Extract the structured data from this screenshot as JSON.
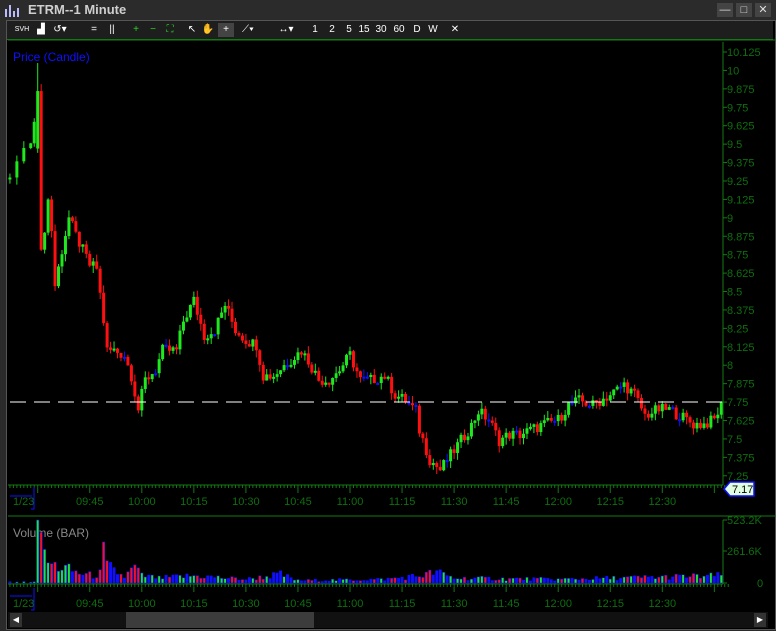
{
  "window": {
    "title": "ETRM--1 Minute",
    "minimize": "—",
    "restore": "□",
    "close": "✕"
  },
  "toolbar": {
    "items": [
      {
        "name": "svh-button",
        "label": "SVH"
      },
      {
        "name": "chart-type-button",
        "label": "▟"
      },
      {
        "name": "reset-button",
        "label": "↺▾"
      },
      {
        "name": "horizontal-line-button",
        "label": "="
      },
      {
        "name": "vertical-line-button",
        "label": "||"
      },
      {
        "name": "zoom-in-button",
        "label": "+"
      },
      {
        "name": "zoom-out-button",
        "label": "−"
      },
      {
        "name": "fit-button",
        "label": "⛶"
      },
      {
        "name": "pointer-button",
        "label": "↖"
      },
      {
        "name": "pan-button",
        "label": "✋"
      },
      {
        "name": "crosshair-button",
        "label": "+"
      },
      {
        "name": "draw-line-button",
        "label": "⟋▾"
      },
      {
        "name": "pan-horizontal-button",
        "label": "↔▾"
      },
      {
        "name": "interval-1",
        "label": "1"
      },
      {
        "name": "interval-2",
        "label": "2"
      },
      {
        "name": "interval-5",
        "label": "5"
      },
      {
        "name": "interval-15",
        "label": "15"
      },
      {
        "name": "interval-30",
        "label": "30"
      },
      {
        "name": "interval-60",
        "label": "60"
      },
      {
        "name": "interval-d",
        "label": "D"
      },
      {
        "name": "interval-w",
        "label": "W"
      },
      {
        "name": "close-chart",
        "label": "✕"
      }
    ]
  },
  "colors": {
    "up": "#1ee81e",
    "down": "#ff1010",
    "neutral": "#1010ff",
    "axis": "#137a13",
    "axis_text": "#0f6e0f"
  },
  "chart_data": [
    {
      "type": "candlestick",
      "title": "Price (Candle)",
      "date_label": "1/23",
      "y_ticks": [
        "10.125",
        "10",
        "9.875",
        "9.75",
        "9.625",
        "9.5",
        "9.375",
        "9.25",
        "9.125",
        "9",
        "8.875",
        "8.75",
        "8.625",
        "8.5",
        "8.375",
        "8.25",
        "8.125",
        "8",
        "7.875",
        "7.75",
        "7.625",
        "7.5",
        "7.375",
        "7.25"
      ],
      "ylim": [
        7.25,
        10.125
      ],
      "x_ticks": [
        "09:45",
        "10:00",
        "10:15",
        "10:30",
        "10:45",
        "11:00",
        "11:15",
        "11:30",
        "11:45",
        "12:00",
        "12:15",
        "12:30"
      ],
      "x_tick_minutes": [
        15,
        30,
        45,
        60,
        75,
        90,
        105,
        120,
        135,
        150,
        165,
        180
      ],
      "reference_line": 7.75,
      "last_price": "7.17",
      "close_keyframes_minutes_from_0930": [
        [
          -8,
          9.26
        ],
        [
          -5,
          9.46
        ],
        [
          -2,
          9.47
        ],
        [
          0,
          9.9
        ],
        [
          1,
          8.75
        ],
        [
          3,
          9.12
        ],
        [
          4,
          8.92
        ],
        [
          5,
          8.54
        ],
        [
          7,
          8.78
        ],
        [
          9,
          9.0
        ],
        [
          11,
          8.88
        ],
        [
          13,
          8.78
        ],
        [
          15,
          8.68
        ],
        [
          17,
          8.66
        ],
        [
          19,
          8.3
        ],
        [
          20,
          8.1
        ],
        [
          22,
          8.1
        ],
        [
          25,
          8.07
        ],
        [
          27,
          7.93
        ],
        [
          29,
          7.7
        ],
        [
          31,
          7.9
        ],
        [
          34,
          7.97
        ],
        [
          36,
          8.1
        ],
        [
          40,
          8.1
        ],
        [
          42,
          8.3
        ],
        [
          45,
          8.44
        ],
        [
          48,
          8.2
        ],
        [
          51,
          8.24
        ],
        [
          54,
          8.41
        ],
        [
          57,
          8.24
        ],
        [
          60,
          8.17
        ],
        [
          63,
          8.14
        ],
        [
          65,
          7.93
        ],
        [
          68,
          7.93
        ],
        [
          71,
          8.0
        ],
        [
          76,
          8.1
        ],
        [
          78,
          8.03
        ],
        [
          81,
          7.9
        ],
        [
          84,
          7.9
        ],
        [
          87,
          7.97
        ],
        [
          90,
          8.07
        ],
        [
          93,
          7.9
        ],
        [
          96,
          7.9
        ],
        [
          100,
          7.93
        ],
        [
          103,
          7.8
        ],
        [
          106,
          7.76
        ],
        [
          109,
          7.69
        ],
        [
          110,
          7.56
        ],
        [
          113,
          7.36
        ],
        [
          116,
          7.29
        ],
        [
          119,
          7.39
        ],
        [
          122,
          7.49
        ],
        [
          125,
          7.59
        ],
        [
          127,
          7.69
        ],
        [
          130,
          7.63
        ],
        [
          133,
          7.49
        ],
        [
          136,
          7.53
        ],
        [
          139,
          7.53
        ],
        [
          142,
          7.56
        ],
        [
          146,
          7.6
        ],
        [
          150,
          7.63
        ],
        [
          153,
          7.73
        ],
        [
          156,
          7.76
        ],
        [
          160,
          7.73
        ],
        [
          165,
          7.8
        ],
        [
          169,
          7.87
        ],
        [
          172,
          7.8
        ],
        [
          175,
          7.66
        ],
        [
          179,
          7.7
        ],
        [
          182,
          7.7
        ],
        [
          185,
          7.66
        ],
        [
          189,
          7.6
        ],
        [
          192,
          7.6
        ],
        [
          195,
          7.63
        ],
        [
          197,
          7.73
        ]
      ],
      "spike_high": 10.05
    },
    {
      "type": "bar",
      "title": "Volume (BAR)",
      "date_label": "1/23",
      "y_ticks": [
        "523.2K",
        "261.6K",
        "0"
      ],
      "ylim": [
        0,
        523.2
      ],
      "volume_keyframes_k": [
        [
          -8,
          8
        ],
        [
          -1,
          8
        ],
        [
          0,
          523
        ],
        [
          1,
          420
        ],
        [
          2,
          200
        ],
        [
          4,
          150
        ],
        [
          8,
          120
        ],
        [
          12,
          80
        ],
        [
          16,
          60
        ],
        [
          18,
          80
        ],
        [
          19,
          240
        ],
        [
          20,
          140
        ],
        [
          22,
          100
        ],
        [
          25,
          50
        ],
        [
          28,
          130
        ],
        [
          30,
          60
        ],
        [
          35,
          40
        ],
        [
          45,
          60
        ],
        [
          55,
          40
        ],
        [
          60,
          30
        ],
        [
          70,
          70
        ],
        [
          75,
          20
        ],
        [
          100,
          30
        ],
        [
          110,
          60
        ],
        [
          115,
          90
        ],
        [
          120,
          40
        ],
        [
          150,
          30
        ],
        [
          197,
          60
        ]
      ]
    }
  ]
}
